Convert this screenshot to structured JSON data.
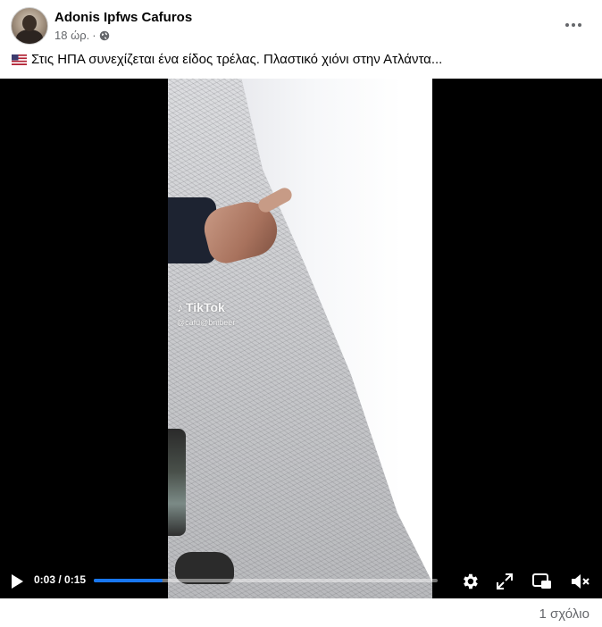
{
  "post": {
    "author": "Adonis Ipfws Cafuros",
    "time": "18 ώρ.",
    "separator": "·",
    "privacy_icon": "globe-icon",
    "caption": "Στις ΗΠΑ συνεχίζεται ένα είδος τρέλας. Πλαστικό χιόνι στην Ατλάντα...",
    "caption_icon": "us-flag-emoji"
  },
  "video": {
    "watermark_brand": "TikTok",
    "watermark_handle": "@cafu@bnibeer",
    "time_display": "0:03 / 0:15",
    "progress": 0.2,
    "accent_color": "#1877f2",
    "controls": {
      "play": "play-icon",
      "settings": "gear-icon",
      "fullscreen": "expand-icon",
      "pip": "picture-in-picture-icon",
      "volume": "volume-muted-icon"
    }
  },
  "footer": {
    "comments": "1 σχόλιο"
  }
}
